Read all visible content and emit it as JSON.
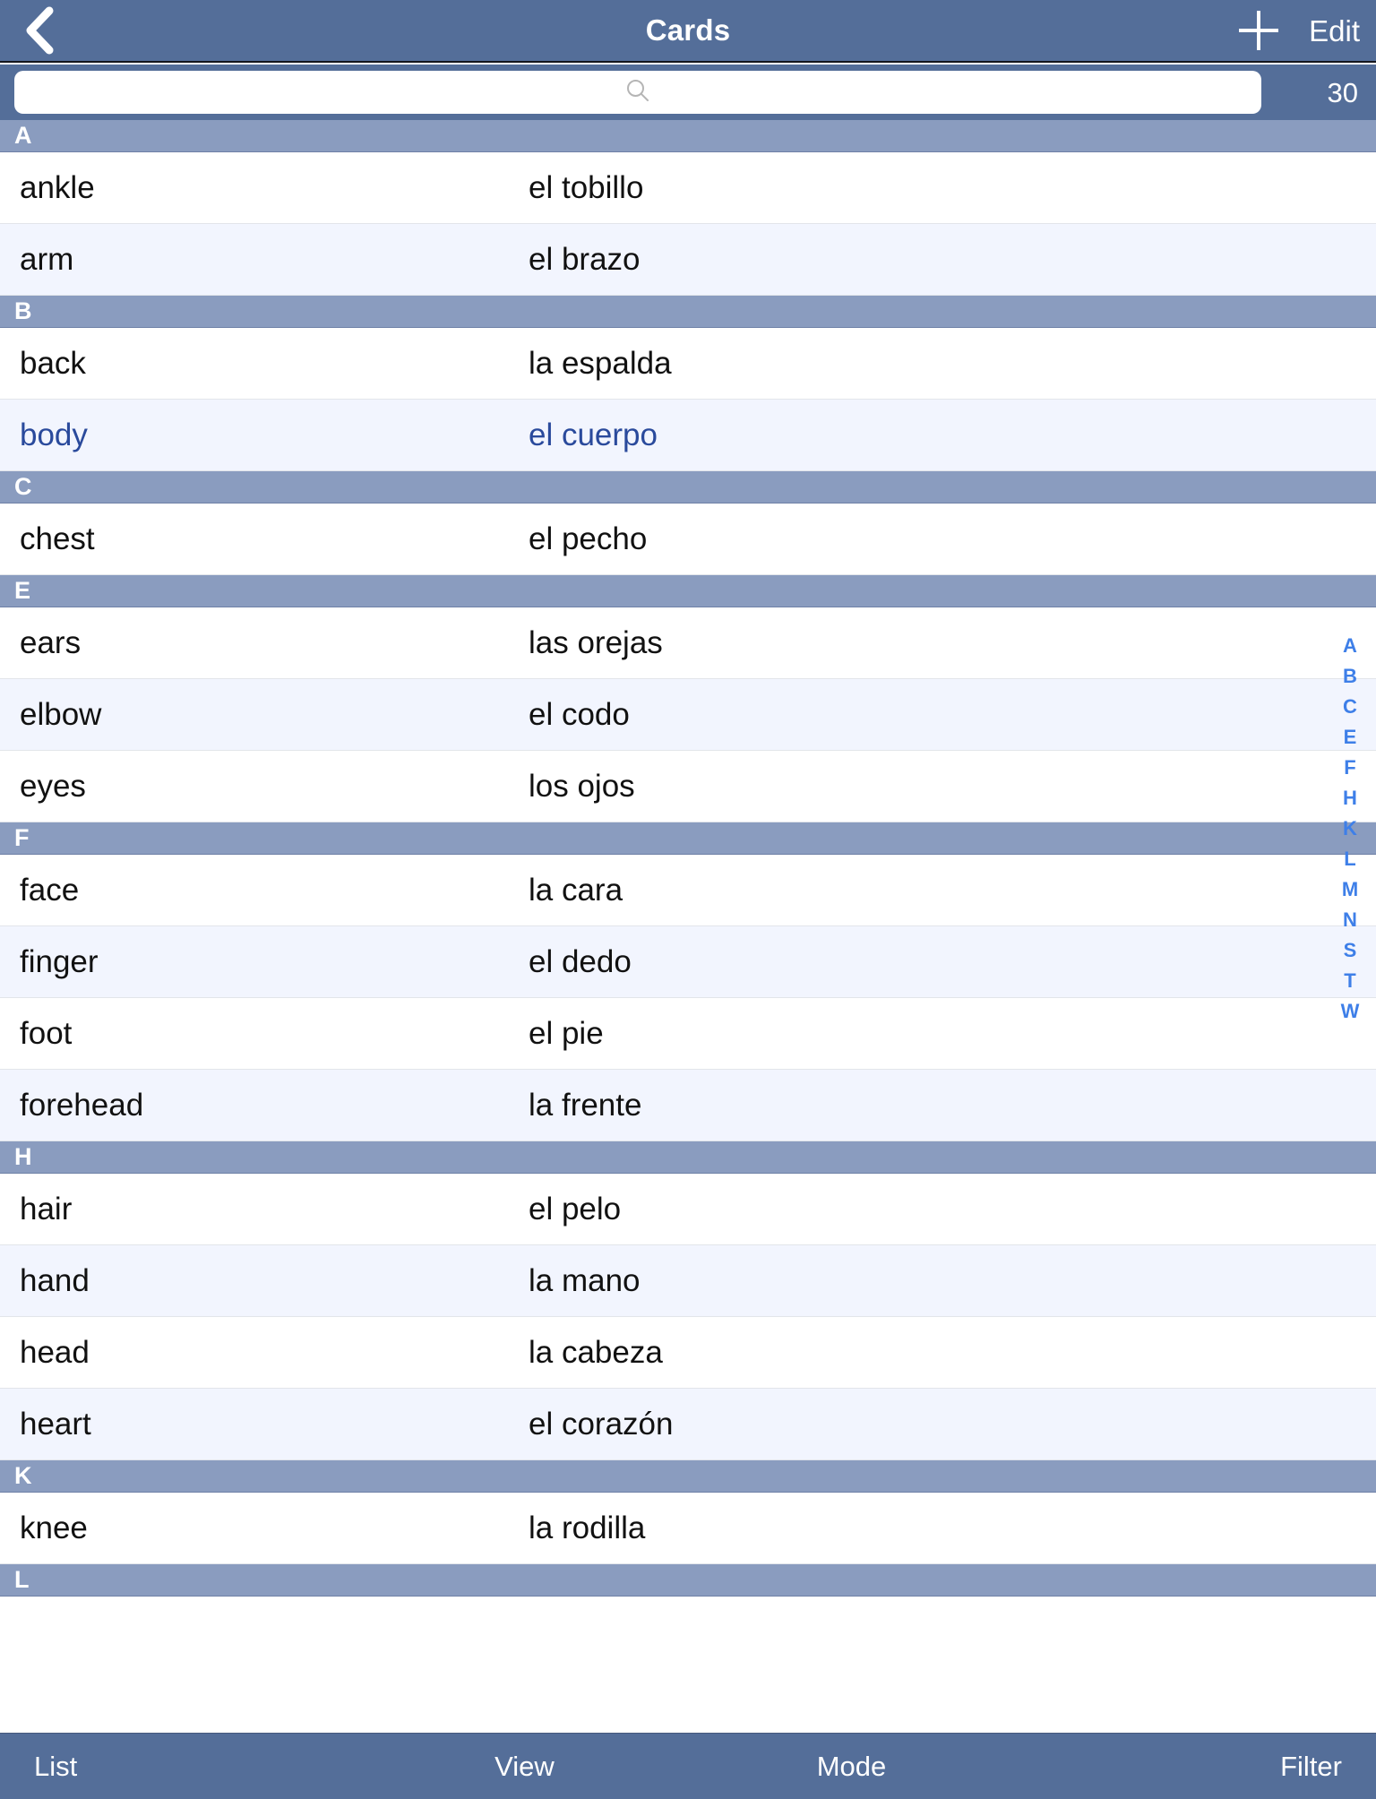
{
  "navbar": {
    "back_icon": "chevron-left-icon",
    "title": "Cards",
    "add_icon": "plus-icon",
    "edit_label": "Edit"
  },
  "search": {
    "icon": "search-icon",
    "value": "",
    "placeholder": "",
    "count": "30"
  },
  "list": {
    "sections": [
      {
        "letter": "A",
        "rows": [
          {
            "term": "ankle",
            "translation": "el tobillo",
            "selected": false
          },
          {
            "term": "arm",
            "translation": "el brazo",
            "selected": false
          }
        ]
      },
      {
        "letter": "B",
        "rows": [
          {
            "term": "back",
            "translation": "la espalda",
            "selected": false
          },
          {
            "term": "body",
            "translation": "el cuerpo",
            "selected": true
          }
        ]
      },
      {
        "letter": "C",
        "rows": [
          {
            "term": "chest",
            "translation": "el pecho",
            "selected": false
          }
        ]
      },
      {
        "letter": "E",
        "rows": [
          {
            "term": "ears",
            "translation": "las orejas",
            "selected": false
          },
          {
            "term": "elbow",
            "translation": "el codo",
            "selected": false
          },
          {
            "term": "eyes",
            "translation": "los ojos",
            "selected": false
          }
        ]
      },
      {
        "letter": "F",
        "rows": [
          {
            "term": "face",
            "translation": "la cara",
            "selected": false
          },
          {
            "term": "finger",
            "translation": "el dedo",
            "selected": false
          },
          {
            "term": "foot",
            "translation": "el pie",
            "selected": false
          },
          {
            "term": "forehead",
            "translation": "la frente",
            "selected": false
          }
        ]
      },
      {
        "letter": "H",
        "rows": [
          {
            "term": "hair",
            "translation": "el pelo",
            "selected": false
          },
          {
            "term": "hand",
            "translation": "la mano",
            "selected": false
          },
          {
            "term": "head",
            "translation": "la cabeza",
            "selected": false
          },
          {
            "term": "heart",
            "translation": "el corazón",
            "selected": false
          }
        ]
      },
      {
        "letter": "K",
        "rows": [
          {
            "term": "knee",
            "translation": "la rodilla",
            "selected": false
          }
        ]
      },
      {
        "letter": "L",
        "rows": []
      }
    ]
  },
  "index_strip": [
    "A",
    "B",
    "C",
    "E",
    "F",
    "H",
    "K",
    "L",
    "M",
    "N",
    "S",
    "T",
    "W"
  ],
  "toolbar": {
    "items": [
      "List",
      "View",
      "Mode",
      "Filter"
    ]
  },
  "colors": {
    "navbar": "#546E99",
    "section_header": "#8A9CBF",
    "row_alt": "#F2F5FE",
    "selected_text": "#2A4A9C",
    "index_blue": "#3E7FE8"
  }
}
